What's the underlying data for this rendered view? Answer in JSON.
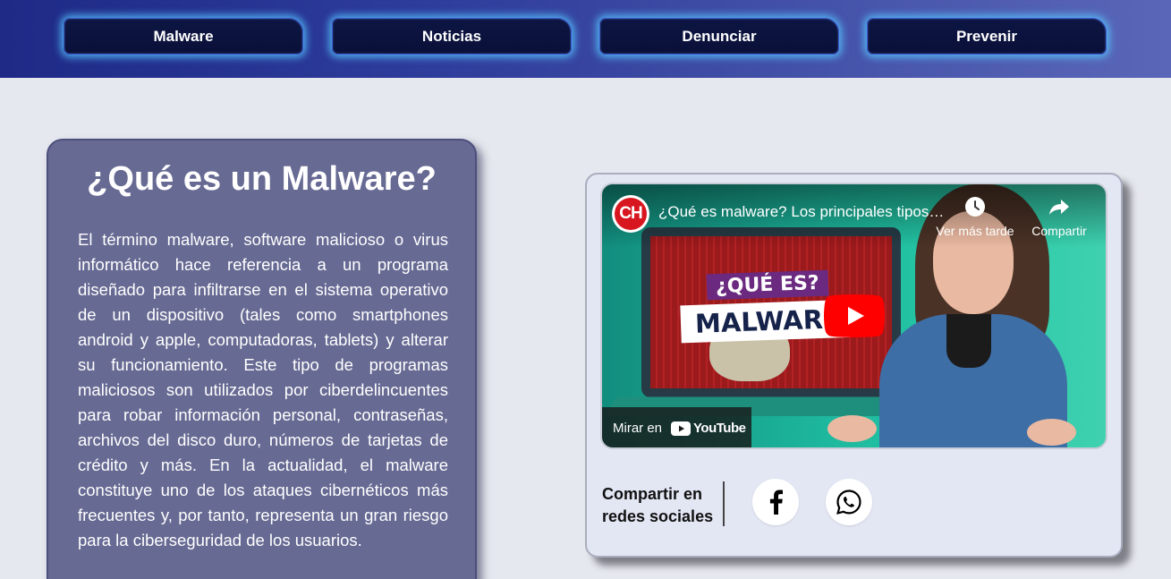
{
  "nav": {
    "items": [
      {
        "label": "Malware"
      },
      {
        "label": "Noticias"
      },
      {
        "label": "Denunciar"
      },
      {
        "label": "Prevenir"
      }
    ]
  },
  "info": {
    "title": "¿Qué es un Malware?",
    "body": "El término malware, software malicioso o virus informático hace referencia a un programa diseñado para infiltrarse en el sistema operativo de un dispositivo (tales como smartphones android y apple, computadoras, tablets) y alterar su funcionamiento. Este tipo de programas maliciosos son utilizados por ciberdelincuentes para robar información personal, contraseñas, archivos del disco duro, números de tarjetas de crédito y más. En la actualidad, el malware constituye uno de los ataques cibernéticos más frecuentes y, por tanto, representa un gran riesgo para la ciberseguridad de los usuarios."
  },
  "video": {
    "channel_logo": "CH",
    "title": "¿Qué es malware? Los principales tipos de malware",
    "watch_later": "Ver más tarde",
    "share": "Compartir",
    "thumb_tag_1": "¿QUÉ ES?",
    "thumb_tag_2": "MALWARE",
    "watch_on": "Mirar en",
    "youtube": "YouTube"
  },
  "share": {
    "label": "Compartir en redes sociales",
    "icons": [
      "facebook-icon",
      "whatsapp-icon"
    ]
  },
  "colors": {
    "topbar_start": "#1e2a86",
    "topbar_end": "#5a67b8",
    "nav_button": "#0d1543",
    "nav_glow": "#56c8ff",
    "info_card": "#676a93",
    "video_card": "#e3e7f4",
    "page_bg": "#e6e8ef"
  }
}
